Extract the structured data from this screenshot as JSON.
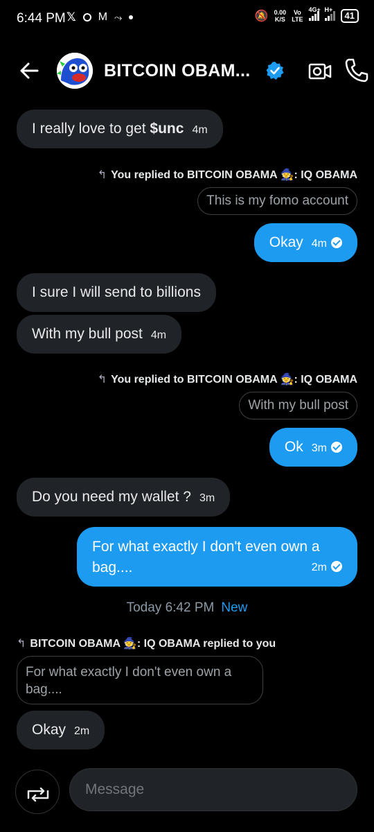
{
  "status_bar": {
    "time": "6:44 PM",
    "net_speed_value": "0.00",
    "net_speed_unit": "K/S",
    "volte_top": "Vo",
    "volte_bottom": "LTE",
    "net1": "4G+",
    "net2": "H+",
    "battery": "41"
  },
  "header": {
    "contact_name": "BITCOIN OBAM...",
    "verified_color": "#1d9bf0"
  },
  "messages": {
    "m1": {
      "text_prefix": "I really love to get ",
      "text_bold": "$unc",
      "time": "4m"
    },
    "reply1_meta": {
      "prefix": "You replied to BITCOIN OBAMA ",
      "emoji": "🧙",
      "suffix": ": IQ OBAMA"
    },
    "quote1": "This is my fomo account",
    "m2": {
      "text": "Okay",
      "time": "4m"
    },
    "m3": {
      "text": "I sure I will send to billions"
    },
    "m4": {
      "text": "With my bull post",
      "time": "4m"
    },
    "reply2_meta": {
      "prefix": "You replied to BITCOIN OBAMA ",
      "emoji": "🧙",
      "suffix": ": IQ OBAMA"
    },
    "quote2": "With my bull post",
    "m5": {
      "text": "Ok",
      "time": "3m"
    },
    "m6": {
      "text": "Do you need my wallet ?",
      "time": "3m"
    },
    "m7": {
      "text": "For what exactly I don't even own a bag....",
      "time": "2m"
    },
    "divider": {
      "date": "Today 6:42 PM",
      "new_label": "New"
    },
    "reply3_meta": {
      "prefix": "BITCOIN OBAMA ",
      "emoji": "🧙",
      "suffix": ": IQ OBAMA replied to you"
    },
    "quote3": "For what exactly I don't even own a bag....",
    "m8": {
      "text": "Okay",
      "time": "2m"
    }
  },
  "composer": {
    "placeholder": "Message"
  },
  "colors": {
    "accent": "#1d9bf0",
    "incoming_bubble": "#202327",
    "background": "#000000"
  }
}
